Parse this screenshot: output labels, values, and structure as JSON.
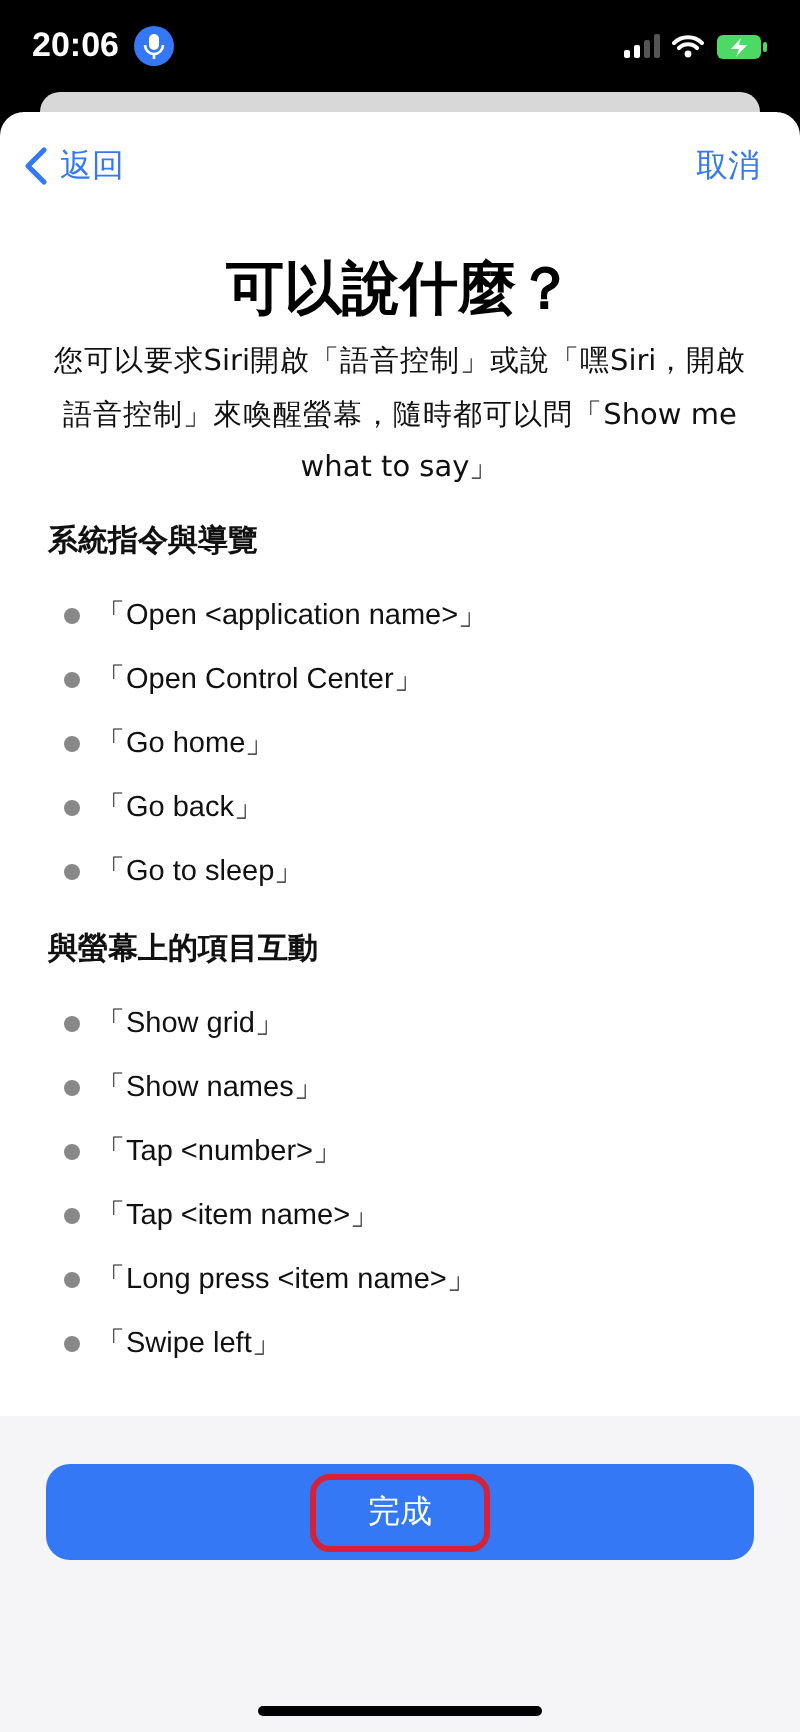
{
  "status_bar": {
    "time": "20:06",
    "mic_active": true
  },
  "nav": {
    "back": "返回",
    "cancel": "取消"
  },
  "title": "可以說什麼？",
  "intro": "您可以要求Siri開啟「語音控制」或說「嘿Siri，開啟語音控制」來喚醒螢幕，隨時都可以問「Show me what to say」",
  "sections": [
    {
      "heading": "系統指令與導覽",
      "items": [
        "「Open <application name>」",
        "「Open Control Center」",
        "「Go home」",
        "「Go back」",
        "「Go to sleep」"
      ]
    },
    {
      "heading": "與螢幕上的項目互動",
      "items": [
        "「Show grid」",
        "「Show names」",
        "「Tap <number>」",
        "「Tap <item name>」",
        "「Long press <item name>」",
        "「Swipe left」"
      ]
    }
  ],
  "done_button": {
    "label": "完成",
    "highlighted": true
  }
}
